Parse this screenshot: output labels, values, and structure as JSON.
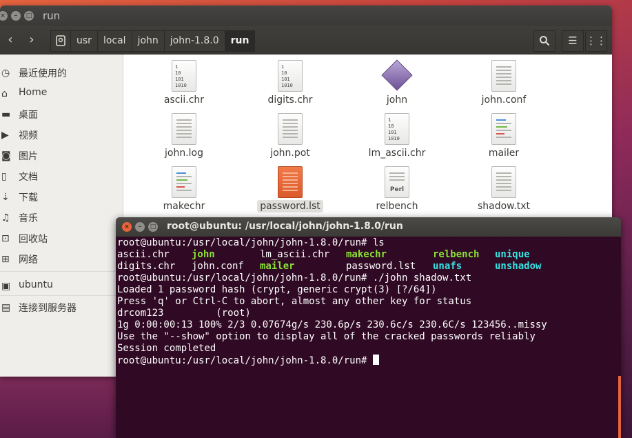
{
  "file_manager": {
    "title": "run",
    "breadcrumbs": [
      "usr",
      "local",
      "john",
      "john-1.8.0",
      "run"
    ],
    "sidebar": [
      {
        "label": "最近使用的",
        "icon": "clock-icon"
      },
      {
        "label": "Home",
        "icon": "home-icon"
      },
      {
        "label": "桌面",
        "icon": "folder-icon"
      },
      {
        "label": "视频",
        "icon": "video-icon"
      },
      {
        "label": "图片",
        "icon": "camera-icon"
      },
      {
        "label": "文档",
        "icon": "document-icon"
      },
      {
        "label": "下载",
        "icon": "download-icon"
      },
      {
        "label": "音乐",
        "icon": "music-icon"
      },
      {
        "label": "回收站",
        "icon": "trash-icon"
      },
      {
        "label": "网络",
        "icon": "network-icon"
      },
      {
        "label": "ubuntu",
        "icon": "drive-icon"
      },
      {
        "label": "连接到服务器",
        "icon": "server-icon"
      }
    ],
    "files": [
      {
        "name": "ascii.chr",
        "type": "binary"
      },
      {
        "name": "digits.chr",
        "type": "binary"
      },
      {
        "name": "john",
        "type": "executable"
      },
      {
        "name": "john.conf",
        "type": "text"
      },
      {
        "name": "john.log",
        "type": "text"
      },
      {
        "name": "john.pot",
        "type": "text"
      },
      {
        "name": "lm_ascii.chr",
        "type": "binary"
      },
      {
        "name": "mailer",
        "type": "script"
      },
      {
        "name": "makechr",
        "type": "script"
      },
      {
        "name": "password.lst",
        "type": "text-selected"
      },
      {
        "name": "relbench",
        "type": "perl"
      },
      {
        "name": "shadow.txt",
        "type": "text"
      }
    ]
  },
  "terminal": {
    "title": "root@ubuntu: /usr/local/john/john-1.8.0/run",
    "prompt": "root@ubuntu:/usr/local/john/john-1.8.0/run# ",
    "cmd_ls": "ls",
    "ls_row1": [
      "ascii.chr",
      "john",
      "lm_ascii.chr",
      "makechr",
      "relbench",
      "unique"
    ],
    "ls_row2": [
      "digits.chr",
      "john.conf",
      "mailer",
      "password.lst",
      "unafs",
      "unshadow"
    ],
    "cmd_john": "./john shadow.txt",
    "output": [
      "Loaded 1 password hash (crypt, generic crypt(3) [?/64])",
      "Press 'q' or Ctrl-C to abort, almost any other key for status",
      "drcom123         (root)",
      "1g 0:00:00:13 100% 2/3 0.07674g/s 230.6p/s 230.6c/s 230.6C/s 123456..missy",
      "Use the \"--show\" option to display all of the cracked passwords reliably",
      "Session completed"
    ],
    "colors": {
      "background": "#300a24",
      "executable": "#8ae234",
      "script": "#34e2e2"
    }
  }
}
